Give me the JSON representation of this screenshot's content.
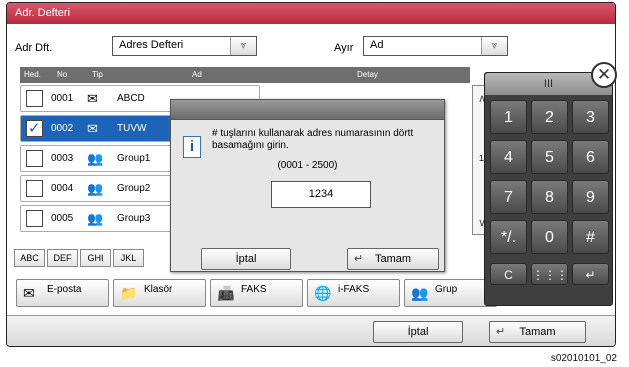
{
  "window": {
    "title": "Adr. Defteri"
  },
  "filters": {
    "addr_label": "Adr Dft.",
    "addr_value": "Adres Defteri",
    "sort_label": "Ayır",
    "sort_value": "Ad"
  },
  "table": {
    "headers": {
      "select": "Hed.",
      "no": "No",
      "type": "Tip",
      "name": "Ad",
      "detail": "Detay"
    },
    "rows": [
      {
        "no": "0001",
        "icon": "envelope-icon",
        "name": "ABCD",
        "selected": false
      },
      {
        "no": "0002",
        "icon": "envelope-icon",
        "name": "TUVW",
        "selected": true
      },
      {
        "no": "0003",
        "icon": "group-icon",
        "name": "Group1",
        "selected": false
      },
      {
        "no": "0004",
        "icon": "group-icon",
        "name": "Group2",
        "selected": false
      },
      {
        "no": "0005",
        "icon": "group-icon",
        "name": "Group3",
        "selected": false
      }
    ],
    "page_indicator": "1/"
  },
  "alpha_tabs": [
    "ABC",
    "DEF",
    "GHI",
    "JKL"
  ],
  "dest_buttons": [
    {
      "label": "E-posta",
      "icon": "email-icon"
    },
    {
      "label": "Klasör",
      "icon": "folder-icon"
    },
    {
      "label": "FAKS",
      "icon": "fax-icon"
    },
    {
      "label": "i-FAKS",
      "icon": "ifax-icon"
    },
    {
      "label": "Grup",
      "icon": "group-icon"
    }
  ],
  "dialog": {
    "message": "# tuşlarını kullanarak adres numarasının dörtt basamağını girin.",
    "range": "(0001 - 2500)",
    "input_value": "1234",
    "cancel": "İptal",
    "ok": "Tamam"
  },
  "keypad": {
    "header_glyph": "III",
    "keys": [
      "1",
      "2",
      "3",
      "4",
      "5",
      "6",
      "7",
      "8",
      "9",
      "*/.",
      "0",
      "#",
      "C",
      "⋮⋮⋮",
      "↵"
    ]
  },
  "footer": {
    "cancel": "İptal",
    "ok": "Tamam"
  },
  "caption": "s02010101_02",
  "colors": {
    "title_bar": "#c83347",
    "selected_row": "#1d63b8"
  }
}
